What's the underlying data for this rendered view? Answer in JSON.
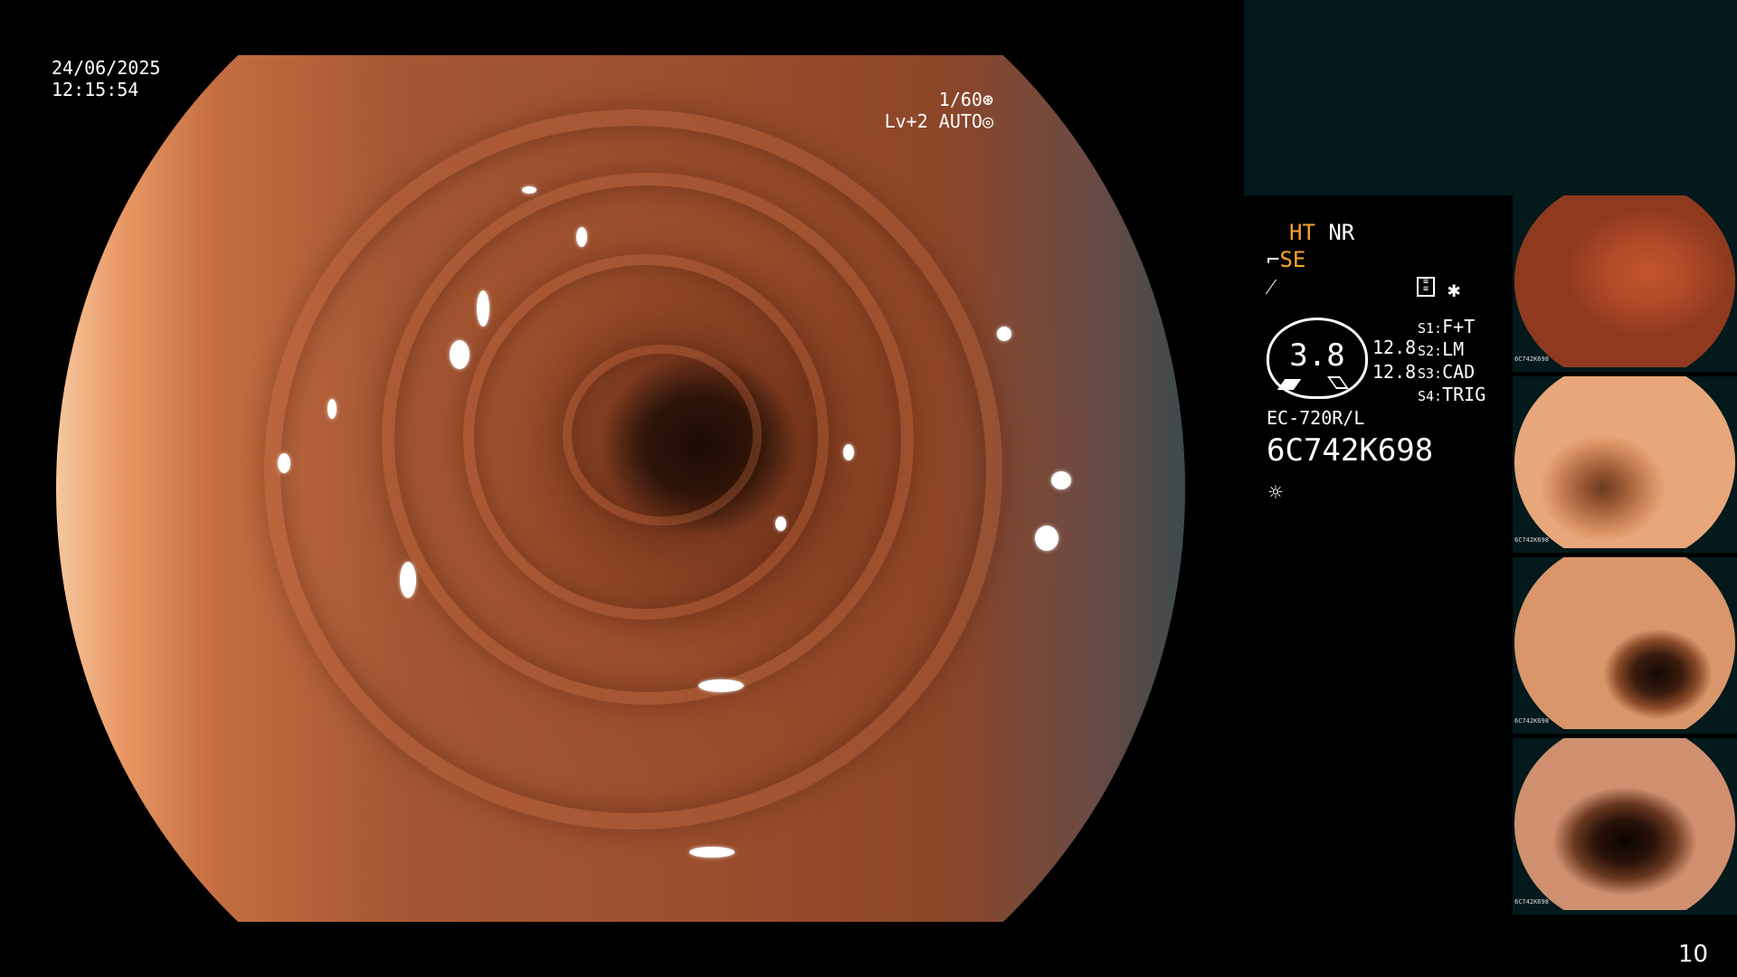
{
  "overlay": {
    "date": "24/06/2025",
    "time": "12:15:54",
    "shutter": "1/60",
    "shutter_icon": "aperture-icon",
    "level": "Lv+2 AUTO",
    "level_icon": "iris-icon"
  },
  "status": {
    "ht": "HT",
    "nr": "NR",
    "se": "SE",
    "se_icon": "scope-icon",
    "f_symbol": "⁄",
    "record_icon": "memory-icon",
    "star": "✱"
  },
  "gauge": {
    "value": "3.8",
    "side_top": "12.8",
    "side_bottom": "12.8"
  },
  "switches": [
    {
      "key": "S1:",
      "value": "F+T"
    },
    {
      "key": "S2:",
      "value": "LM"
    },
    {
      "key": "S3:",
      "value": "CAD"
    },
    {
      "key": "S4:",
      "value": "TRIG"
    }
  ],
  "scope": {
    "model": "EC-720R/L",
    "serial": "6C742K698",
    "light_icon": "sun-icon"
  },
  "thumbnails": [
    {
      "serial": "6C742K698"
    },
    {
      "serial": "6C742K698"
    },
    {
      "serial": "6C742K698"
    },
    {
      "serial": "6C742K698"
    }
  ],
  "page_number": "10",
  "colors": {
    "accent": "#f7a427",
    "panel": "#03191b",
    "background": "#000000"
  }
}
